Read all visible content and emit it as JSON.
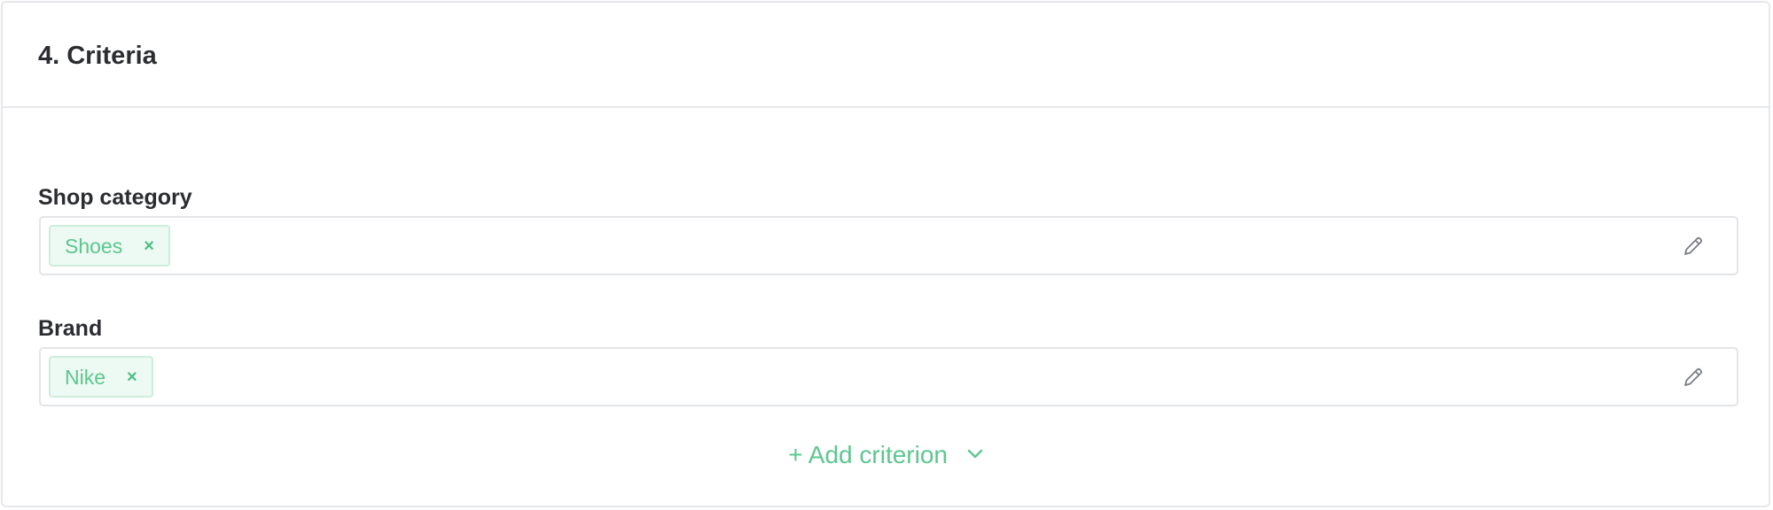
{
  "section": {
    "title": "4. Criteria"
  },
  "criteria": [
    {
      "label": "Shop category",
      "tags": [
        "Shoes"
      ]
    },
    {
      "label": "Brand",
      "tags": [
        "Nike"
      ]
    }
  ],
  "actions": {
    "add_criterion": "+ Add criterion",
    "chip_remove_symbol": "×"
  },
  "colors": {
    "accent": "#5cc78f",
    "chip_bg": "#edf9f3",
    "chip_border": "#cdeedd",
    "text": "#2b2d30",
    "border": "#e6e8eb"
  },
  "icons": {
    "edit": "pencil-icon",
    "remove": "close-icon",
    "dropdown": "chevron-down-icon"
  }
}
